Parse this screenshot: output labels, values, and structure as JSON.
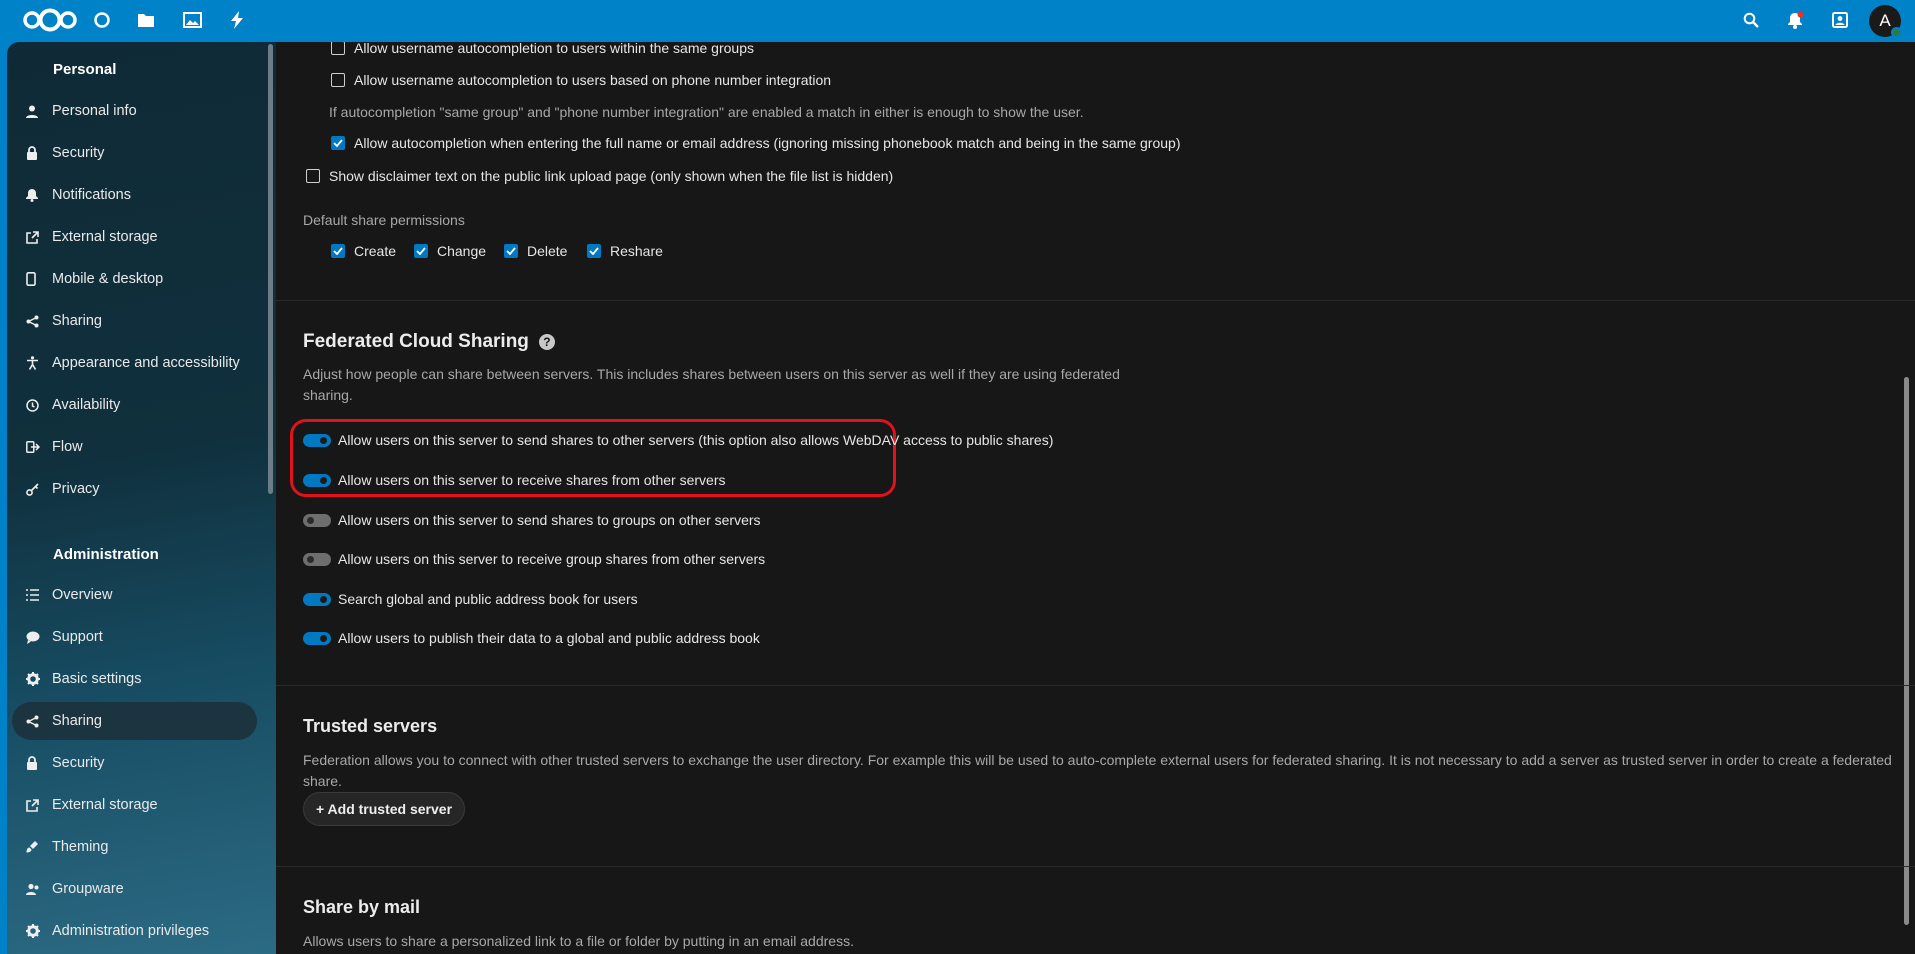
{
  "topbar": {
    "logo_icon": "nextcloud-logo-icon",
    "apps": [
      {
        "name": "dashboard-icon"
      },
      {
        "name": "files-icon"
      },
      {
        "name": "photos-icon"
      },
      {
        "name": "activity-icon"
      }
    ],
    "right_icons": [
      "search-icon",
      "notifications-icon",
      "contacts-icon"
    ],
    "avatar_initial": "A"
  },
  "sidebar": {
    "personal_caption": "Personal",
    "personal_items": [
      {
        "label": "Personal info",
        "icon": "person-icon"
      },
      {
        "label": "Security",
        "icon": "lock-icon"
      },
      {
        "label": "Notifications",
        "icon": "bell-icon"
      },
      {
        "label": "External storage",
        "icon": "external-link-icon"
      },
      {
        "label": "Mobile & desktop",
        "icon": "phone-icon"
      },
      {
        "label": "Sharing",
        "icon": "share-icon"
      },
      {
        "label": "Appearance and accessibility",
        "icon": "accessibility-icon"
      },
      {
        "label": "Availability",
        "icon": "clock-icon"
      },
      {
        "label": "Flow",
        "icon": "flow-icon"
      },
      {
        "label": "Privacy",
        "icon": "key-icon"
      }
    ],
    "admin_caption": "Administration",
    "admin_items": [
      {
        "label": "Overview",
        "icon": "list-icon"
      },
      {
        "label": "Support",
        "icon": "chat-icon"
      },
      {
        "label": "Basic settings",
        "icon": "gear-icon"
      },
      {
        "label": "Sharing",
        "icon": "share-icon",
        "active": true
      },
      {
        "label": "Security",
        "icon": "lock-icon"
      },
      {
        "label": "External storage",
        "icon": "external-link-icon"
      },
      {
        "label": "Theming",
        "icon": "paint-icon"
      },
      {
        "label": "Groupware",
        "icon": "groupware-icon"
      },
      {
        "label": "Administration privileges",
        "icon": "gear-icon"
      }
    ]
  },
  "sharing": {
    "autocomplete_same_groups": "Allow username autocompletion to users within the same groups",
    "autocomplete_phone": "Allow username autocompletion to users based on phone number integration",
    "autocomplete_hint": "If autocompletion \"same group\" and \"phone number integration\" are enabled a match in either is enough to show the user.",
    "autocomplete_full_name": "Allow autocompletion when entering the full name or email address (ignoring missing phonebook match and being in the same group)",
    "disclaimer": "Show disclaimer text on the public link upload page (only shown when the file list is hidden)",
    "default_perms_label": "Default share permissions",
    "perms": [
      {
        "label": "Create",
        "checked": true
      },
      {
        "label": "Change",
        "checked": true
      },
      {
        "label": "Delete",
        "checked": true
      },
      {
        "label": "Reshare",
        "checked": true
      }
    ]
  },
  "federated": {
    "title": "Federated Cloud Sharing",
    "help_glyph": "?",
    "desc_line1": "Adjust how people can share between servers. This includes shares between users on this server as well if they are using federated",
    "desc_line2": "sharing.",
    "toggles": [
      {
        "label": "Allow users on this server to send shares to other servers (this option also allows WebDAV access to public shares)",
        "on": true
      },
      {
        "label": "Allow users on this server to receive shares from other servers",
        "on": true
      },
      {
        "label": "Allow users on this server to send shares to groups on other servers",
        "on": false
      },
      {
        "label": "Allow users on this server to receive group shares from other servers",
        "on": false
      },
      {
        "label": "Search global and public address book for users",
        "on": true
      },
      {
        "label": "Allow users to publish their data to a global and public address book",
        "on": true
      }
    ]
  },
  "trusted": {
    "title": "Trusted servers",
    "desc": "Federation allows you to connect with other trusted servers to exchange the user directory. For example this will be used to auto-complete external users for federated sharing. It is not necessary to add a server as trusted server in order to create a federated share.",
    "add_button": "+ Add trusted server"
  },
  "share_by_mail": {
    "title": "Share by mail",
    "desc": "Allows users to share a personalized link to a file or folder by putting in an email address."
  },
  "colors": {
    "header": "#0082c9",
    "background": "#171717",
    "accent": "#0078c2",
    "highlight": "#e0121b"
  }
}
